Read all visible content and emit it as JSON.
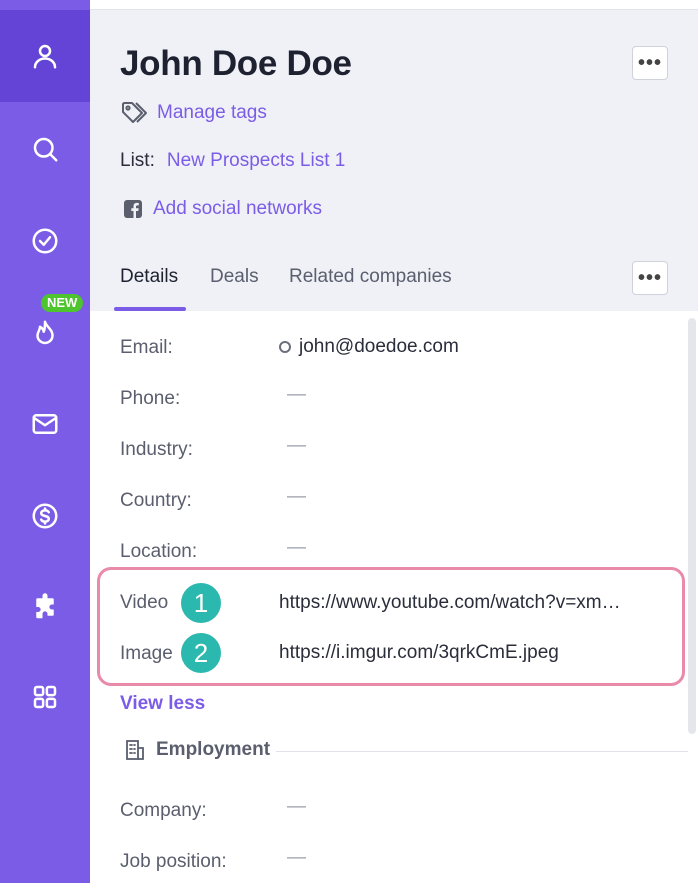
{
  "sidebar": {
    "items": [
      {
        "icon": "user-icon"
      },
      {
        "icon": "search-icon"
      },
      {
        "icon": "check-circle-icon"
      },
      {
        "icon": "fire-icon"
      },
      {
        "icon": "mail-icon"
      },
      {
        "icon": "dollar-icon"
      },
      {
        "icon": "puzzle-icon"
      },
      {
        "icon": "apps-icon"
      }
    ],
    "new_badge": "NEW"
  },
  "contact": {
    "name": "John Doe Doe",
    "manage_tags": "Manage tags",
    "list_label": "List:",
    "list_value": "New Prospects List 1",
    "add_social": "Add social networks"
  },
  "tabs": [
    {
      "label": "Details"
    },
    {
      "label": "Deals"
    },
    {
      "label": "Related companies"
    }
  ],
  "fields": {
    "email_label": "Email:",
    "email_value": "john@doedoe.com",
    "phone_label": "Phone:",
    "industry_label": "Industry:",
    "country_label": "Country:",
    "location_label": "Location:",
    "empty": "—",
    "video_label": "Video",
    "video_value": "https://www.youtube.com/watch?v=xm…",
    "image_label": "Image",
    "image_value": "https://i.imgur.com/3qrkCmE.jpeg",
    "marker_1": "1",
    "marker_2": "2"
  },
  "view_less": "View less",
  "employment": {
    "title": "Employment",
    "company_label": "Company:",
    "job_label": "Job position:"
  },
  "colors": {
    "sidebar": "#7b5ce6",
    "accent": "#7b5ce6",
    "highlight": "#e98aa9",
    "marker": "#2bb8ae",
    "badge": "#4ec42f"
  }
}
